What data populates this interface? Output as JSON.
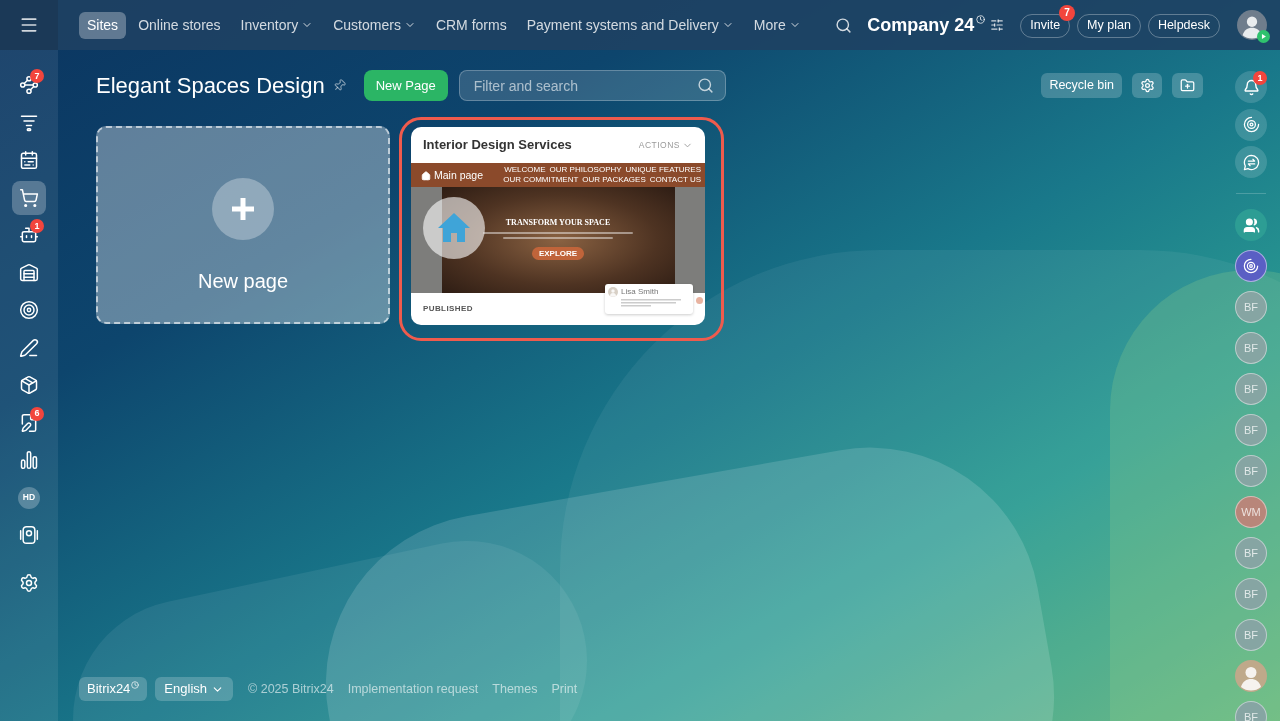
{
  "left_sidebar": {
    "items": [
      {
        "kind": "icon",
        "badge": "7",
        "selected": false
      },
      {
        "kind": "icon",
        "selected": false
      },
      {
        "kind": "icon",
        "selected": false
      },
      {
        "kind": "icon",
        "selected": true
      },
      {
        "kind": "icon",
        "badge": "1",
        "selected": false
      },
      {
        "kind": "icon",
        "selected": false
      },
      {
        "kind": "icon",
        "selected": false
      },
      {
        "kind": "icon",
        "selected": false
      },
      {
        "kind": "icon",
        "selected": false
      },
      {
        "kind": "icon",
        "badge": "6",
        "selected": false
      },
      {
        "kind": "icon",
        "selected": false
      },
      {
        "kind": "initials",
        "initials": "HD",
        "selected": false
      },
      {
        "kind": "icon",
        "selected": false
      },
      {
        "kind": "icon",
        "selected": false
      }
    ]
  },
  "top_bar": {
    "tabs": [
      {
        "label": "Sites",
        "selected": true,
        "dropdown": false
      },
      {
        "label": "Online stores",
        "selected": false,
        "dropdown": false
      },
      {
        "label": "Inventory",
        "selected": false,
        "dropdown": true
      },
      {
        "label": "Customers",
        "selected": false,
        "dropdown": true
      },
      {
        "label": "CRM forms",
        "selected": false,
        "dropdown": false
      },
      {
        "label": "Payment systems and Delivery",
        "selected": false,
        "dropdown": true
      },
      {
        "label": "More",
        "selected": false,
        "dropdown": true
      }
    ],
    "company": "Company 24",
    "buttons": [
      {
        "label": "Invite",
        "badge": "7"
      },
      {
        "label": "My plan"
      },
      {
        "label": "Helpdesk"
      }
    ]
  },
  "page_header": {
    "title": "Elegant Spaces Design",
    "new_page_button": "New Page",
    "search": {
      "placeholder": "Filter and search"
    },
    "recycle_bin_button": "Recycle bin"
  },
  "new_page_card": {
    "label": "New page"
  },
  "site_card": {
    "title": "Interior Design Services",
    "actions": "ACTIONS",
    "highlighted": true,
    "page_label": "Main page",
    "status": "PUBLISHED",
    "preview": {
      "nav_items": [
        "WELCOME",
        "OUR PHILOSOPHY",
        "UNIQUE FEATURES",
        "OUR COMMITMENT",
        "OUR PACKAGES",
        "CONTACT US"
      ],
      "hero_title": "TRANSFORM YOUR SPACE",
      "hero_button": "EXPLORE",
      "chat_name": "Lisa Smith"
    }
  },
  "right_panel": {
    "notifications_badge": "1",
    "contacts": [
      {
        "kind": "group",
        "color": "#2d9d94"
      },
      {
        "kind": "assistant",
        "color": "#5a5fc4"
      },
      {
        "kind": "initials",
        "initials": "BF",
        "color": "#86a5a3"
      },
      {
        "kind": "initials",
        "initials": "BF",
        "color": "#86a5a3"
      },
      {
        "kind": "initials",
        "initials": "BF",
        "color": "#86a5a3"
      },
      {
        "kind": "initials",
        "initials": "BF",
        "color": "#86a5a3"
      },
      {
        "kind": "initials",
        "initials": "BF",
        "color": "#86a5a3"
      },
      {
        "kind": "initials",
        "initials": "WM",
        "color": "#b8867a"
      },
      {
        "kind": "initials",
        "initials": "BF",
        "color": "#86a5a3"
      },
      {
        "kind": "initials",
        "initials": "BF",
        "color": "#86a5a3"
      },
      {
        "kind": "initials",
        "initials": "BF",
        "color": "#86a5a3"
      },
      {
        "kind": "photo"
      },
      {
        "kind": "initials",
        "initials": "BF",
        "color": "#86a5a3"
      }
    ]
  },
  "footer": {
    "brand": "Bitrix24",
    "language": "English",
    "copyright": "© 2025 Bitrix24",
    "links": [
      "Implementation request",
      "Themes",
      "Print"
    ]
  }
}
